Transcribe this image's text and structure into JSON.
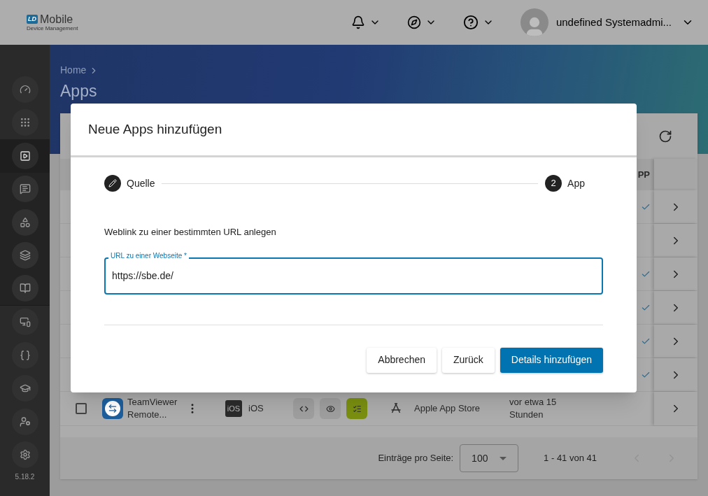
{
  "header": {
    "logo_badge": "LD",
    "logo_title": "Mobile",
    "logo_subtitle": "Device Management",
    "user_name": "undefined Systemadmi..."
  },
  "sidebar": {
    "items": [
      {
        "selected": false
      },
      {
        "selected": false
      },
      {
        "selected": true
      },
      {
        "selected": false
      },
      {
        "selected": false
      },
      {
        "selected": false
      },
      {
        "selected": false
      },
      {
        "selected": false
      },
      {
        "selected": false
      },
      {
        "selected": false
      },
      {
        "selected": false
      },
      {
        "selected": false
      }
    ],
    "version": "5.18.2"
  },
  "breadcrumb": [
    "Home"
  ],
  "page_title": "Apps",
  "table": {
    "column_fragment": "PP",
    "rows": [
      {
        "checked": true
      },
      {
        "checked": false
      },
      {
        "checked": true
      },
      {
        "checked": true
      },
      {
        "checked": true
      },
      {
        "checked": true
      }
    ],
    "visible_row": {
      "selected": false,
      "name": "TeamViewer Remote...",
      "platform_badge": "iOS",
      "platform": "iOS",
      "tiles": [
        {
          "active": false
        },
        {
          "active": false
        },
        {
          "active": true
        }
      ],
      "store": "Apple App Store",
      "updated": "vor etwa 15 Stunden"
    }
  },
  "pagination": {
    "label": "Einträge pro Seite:",
    "page_size": "100",
    "range": "1 - 41 von 41",
    "prev_disabled": true,
    "next_disabled": true
  },
  "dialog": {
    "title": "Neue Apps hinzufügen",
    "steps": [
      {
        "label": "Quelle",
        "kind": "edit"
      },
      {
        "label": "App",
        "kind": "number",
        "number": "2"
      }
    ],
    "description": "Weblink zu einer bestimmten URL anlegen",
    "field": {
      "label": "URL zu einer Webseite *",
      "value": "https://sbe.de/"
    },
    "buttons": [
      {
        "label": "Abbrechen",
        "primary": false
      },
      {
        "label": "Zurück",
        "primary": false
      },
      {
        "label": "Details hinzufügen",
        "primary": true
      }
    ]
  }
}
